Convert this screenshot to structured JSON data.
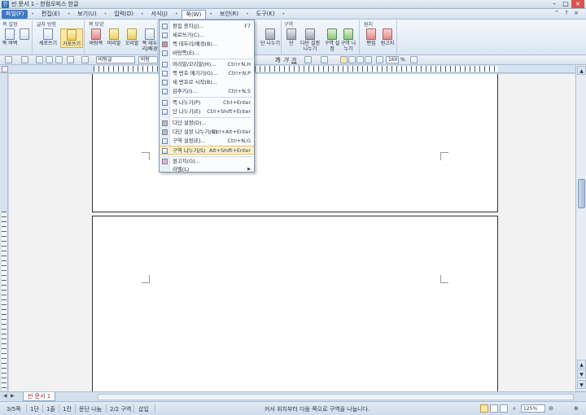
{
  "window": {
    "title": "빈 문서 1 - 한컴오피스 한글"
  },
  "menubar": {
    "items": [
      "파일(F)",
      "편집(E)",
      "보기(U)",
      "입력(D)",
      "서식(J)",
      "쪽(W)",
      "보안(R)",
      "도구(K)"
    ]
  },
  "ribbon": {
    "groups": [
      {
        "title": "쪽 설정",
        "buttons": [
          "쪽 여백",
          ""
        ]
      },
      {
        "title": "글자 방향",
        "buttons": [
          "세로쓰기",
          "가로쓰기"
        ]
      },
      {
        "title": "쪽 모양",
        "buttons": [
          "바탕쪽",
          "머리말",
          "꼬리말",
          "쪽 테두리/배경"
        ]
      },
      {
        "title": "구역",
        "buttons": [
          "단",
          "다단 설정 나누기",
          "구역 설정",
          "구역 나누기"
        ]
      },
      {
        "title": "원지",
        "buttons": [
          "편집",
          "원고지"
        ]
      }
    ],
    "partial_labels": [
      "단",
      "나누기"
    ]
  },
  "toolbar": {
    "style_combo": "바탕글",
    "font_combo": "바탕",
    "fontsize": "160",
    "fontsize_unit": "%",
    "bold": "가",
    "italic": "가",
    "underline": "가"
  },
  "dropdown": {
    "items": [
      {
        "label": "편집 용지(J)...",
        "shortcut": "F7",
        "highlight": false
      },
      {
        "label": "세로쓰기(C)...",
        "shortcut": "",
        "highlight": false
      },
      {
        "label": "쪽 테두리/배경(B)...",
        "shortcut": "",
        "highlight": false
      },
      {
        "label": "바탕쪽(E)...",
        "shortcut": "",
        "highlight": false
      },
      {
        "label": "머리말/꼬리말(H)...",
        "shortcut": "Ctrl+N,H",
        "highlight": false
      },
      {
        "label": "쪽 번호 매기기(G)...",
        "shortcut": "Ctrl+N,P",
        "highlight": false
      },
      {
        "label": "새 번호로 시작(B)...",
        "shortcut": "",
        "highlight": false
      },
      {
        "label": "감추기(I)...",
        "shortcut": "Ctrl+N,S",
        "highlight": false
      },
      {
        "label": "쪽 나누기(P)",
        "shortcut": "Ctrl+Enter",
        "highlight": false
      },
      {
        "label": "단 나누기(E)",
        "shortcut": "Ctrl+Shift+Enter",
        "highlight": false
      },
      {
        "label": "다단 설정(D)...",
        "shortcut": "",
        "highlight": false
      },
      {
        "label": "다단 설정 나누기(N)",
        "shortcut": "Ctrl+Alt+Enter",
        "highlight": false
      },
      {
        "label": "구역 설정(E)...",
        "shortcut": "Ctrl+N,G",
        "highlight": false
      },
      {
        "label": "구역 나누기(S)",
        "shortcut": "Alt+Shift+Enter",
        "highlight": true
      },
      {
        "label": "원고지(G)...",
        "shortcut": "",
        "highlight": false
      },
      {
        "label": "라벨(L)",
        "shortcut": "",
        "highlight": false
      }
    ]
  },
  "tabs": {
    "doc_tab": "빈 문서 1"
  },
  "statusbar": {
    "page": "3/5쪽",
    "section": "1단",
    "line": "1줄",
    "col": "1칸",
    "split": "문단 나눔",
    "area": "2/2 구역",
    "mode": "삽입",
    "message": "커서 위치부터 다음 쪽으로 구역을 나눕니다.",
    "zoom": "125%"
  }
}
